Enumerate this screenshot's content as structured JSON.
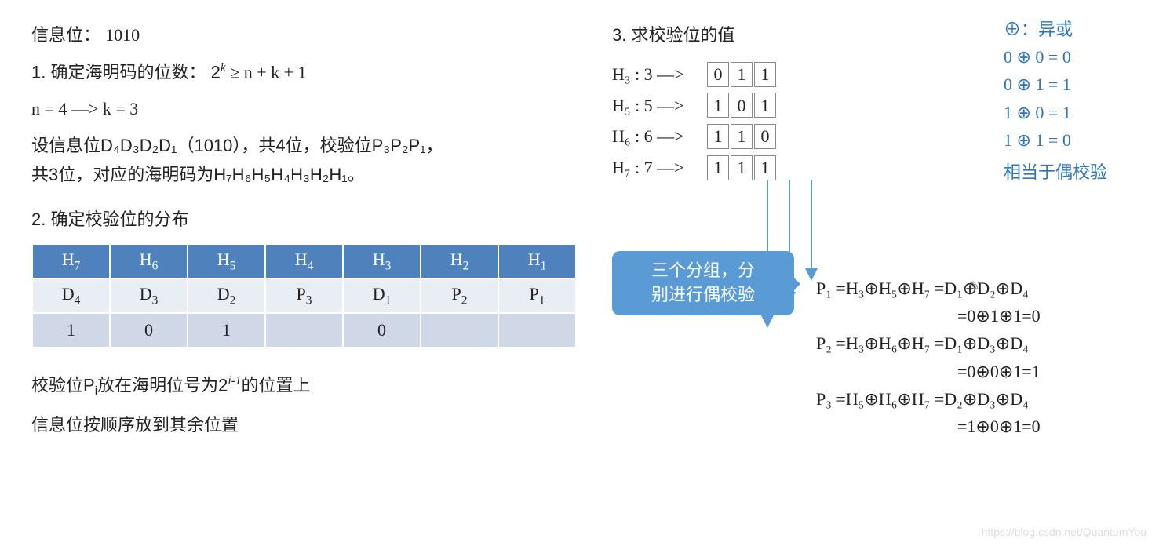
{
  "left": {
    "info_bits_label": "信息位：",
    "info_bits_value": "1010",
    "step1_label": "1.  确定海明码的位数：  2",
    "step1_sup": "k",
    "step1_tail": " ≥ n + k + 1",
    "nk_line": "n = 4    —>    k = 3",
    "desc1": "设信息位D₄D₃D₂D₁（1010），共4位，校验位P₃P₂P₁，",
    "desc2": "共3位，对应的海明码为H₇H₆H₅H₄H₃H₂H₁。",
    "step2_label": "2.  确定校验位的分布",
    "table": {
      "headers_h": [
        "H",
        "H",
        "H",
        "H",
        "H",
        "H",
        "H"
      ],
      "headers_sub": [
        "7",
        "6",
        "5",
        "4",
        "3",
        "2",
        "1"
      ],
      "row1_sym": [
        "D",
        "D",
        "D",
        "P",
        "D",
        "P",
        "P"
      ],
      "row1_sub": [
        "4",
        "3",
        "2",
        "3",
        "1",
        "2",
        "1"
      ],
      "row2": [
        "1",
        "0",
        "1",
        "",
        "0",
        "",
        ""
      ]
    },
    "note1_a": "校验位P",
    "note1_sub": "i",
    "note1_b": "放在海明位号为2",
    "note1_sup": "i-1",
    "note1_c": "的位置上",
    "note2": "信息位按顺序放到其余位置"
  },
  "right": {
    "step3_label": "3.  求校验位的值",
    "xor_title": "⊕：异或",
    "xor_lines": [
      "0 ⊕ 0  =  0",
      "0 ⊕ 1  =  1",
      "1 ⊕ 0  =  1",
      "1 ⊕ 1  =  0"
    ],
    "xor_note": "相当于偶校验",
    "bin_rows": [
      {
        "label": "H₃  :  3 —>",
        "d": [
          "0",
          "1",
          "1"
        ]
      },
      {
        "label": "H₅  :  5 —>",
        "d": [
          "1",
          "0",
          "1"
        ]
      },
      {
        "label": "H₆  :  6 —>",
        "d": [
          "1",
          "1",
          "0"
        ]
      },
      {
        "label": "H₇  :  7 —>",
        "d": [
          "1",
          "1",
          "1"
        ]
      }
    ],
    "callout_l1": "三个分组，分",
    "callout_l2": "别进行偶校验",
    "formulas": [
      {
        "lhs": "P₁ =H₃⊕H₅⊕H₇ =D₁⊕D₂⊕D₄",
        "rhs": "=0⊕1⊕1=0"
      },
      {
        "lhs": "P₂ =H₃⊕H₆⊕H₇ =D₁⊕D₃⊕D₄",
        "rhs": "=0⊕0⊕1=1"
      },
      {
        "lhs": "P₃ =H₅⊕H₆⊕H₇ =D₂⊕D₃⊕D₄",
        "rhs": "=1⊕0⊕1=0"
      }
    ]
  },
  "watermark": "https://blog.csdn.net/QuantumYou",
  "chart_data": {
    "type": "table",
    "description": "Hamming code bit layout table",
    "columns": [
      "H7",
      "H6",
      "H5",
      "H4",
      "H3",
      "H2",
      "H1"
    ],
    "rows": [
      [
        "D4",
        "D3",
        "D2",
        "P3",
        "D1",
        "P2",
        "P1"
      ],
      [
        "1",
        "0",
        "1",
        "",
        "0",
        "",
        ""
      ]
    ]
  }
}
